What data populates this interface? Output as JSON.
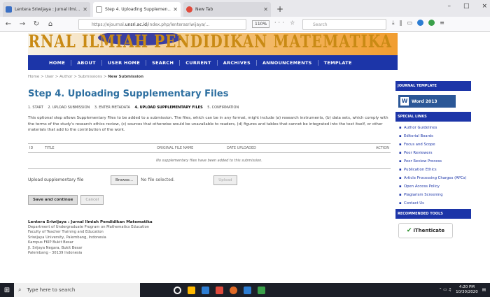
{
  "browser": {
    "tabs": [
      {
        "title": "Lentera Sriwijaya : Jurnal Ilmi...",
        "favicon_color": "#3a6fc4",
        "active": false
      },
      {
        "title": "Step 4. Uploading Supplemen...",
        "favicon_color": "#ffffff",
        "active": true
      },
      {
        "title": "New Tab",
        "favicon_color": "#e04a3c",
        "active": false
      }
    ],
    "new_tab": "+",
    "window_controls": [
      "–",
      "□",
      "×"
    ],
    "url_prefix": "https://ejournal.",
    "url_domain": "unsri.ac.id",
    "url_suffix": "/index.php/lenterasriwijaya/...",
    "zoom": "110%",
    "search_placeholder": "Search"
  },
  "site": {
    "journal_title": "JURNAL ILMIAH PENDIDIKAN MATEMATIKA",
    "menu": [
      "HOME",
      "ABOUT",
      "USER HOME",
      "SEARCH",
      "CURRENT",
      "ARCHIVES",
      "ANNOUNCEMENTS",
      "TEMPLATE"
    ]
  },
  "page": {
    "breadcrumb": [
      "Home",
      "User",
      "Author",
      "Submissions",
      "New Submission"
    ],
    "title": "Step 4. Uploading Supplementary Files",
    "steps": [
      "1. START",
      "2. UPLOAD SUBMISSION",
      "3. ENTER METADATA",
      "4. UPLOAD SUPPLEMENTARY FILES",
      "5. CONFIRMATION"
    ],
    "description": "This optional step allows Supplementary Files to be added to a submission. The files, which can be in any format, might include (a) research instruments, (b) data sets, which comply with the terms of the study's research ethics review, (c) sources that otherwise would be unavailable to readers, (d) figures and tables that cannot be integrated into the text itself, or other materials that add to the contribution of the work.",
    "table_headers": [
      "ID",
      "TITLE",
      "ORIGINAL FILE NAME",
      "DATE UPLOADED",
      "ACTION"
    ],
    "table_empty": "No supplementary files have been added to this submission.",
    "upload_label": "Upload supplementary file",
    "browse_label": "Browse...",
    "no_file": "No file selected.",
    "upload_button": "Upload",
    "save_button": "Save and continue",
    "cancel_button": "Cancel",
    "footer": {
      "heading": "Lentera Sriwijaya : Jurnal Ilmiah Pendidikan Matematika",
      "lines": [
        "Department of Undergraduate Program on Mathematics Education",
        "Faculty of Teacher Training and Education",
        "Sriwijaya University, Palembang, Indonesia",
        "Kampus FKIP Bukit Besar",
        "Jl. Srijaya Negara, Bukit Besar",
        "Palembang - 30139 Indonesia"
      ]
    }
  },
  "sidebar": {
    "template_heading": "JOURNAL TEMPLATE",
    "word_label": "Word 2013",
    "links_heading": "SPECIAL LINKS",
    "links": [
      "Author Guidelines",
      "Editorial Boards",
      "Focus and Scope",
      "Peer Reviewers",
      "Peer Review Process",
      "Publication Ethics",
      "Article Processing Charges (APCs)",
      "Open Access Policy",
      "Plagiarism Screening",
      "Contact Us"
    ],
    "tools_heading": "RECOMMENDED TOOLS",
    "tool_name": "iThenticate"
  },
  "taskbar": {
    "search_placeholder": "Type here to search",
    "time": "4:20 PM",
    "date": "10/30/2020",
    "app_colors": [
      "#f3f3f3",
      "#ffb900",
      "#2d7dd2",
      "#e04a3c",
      "#e06a26",
      "#2d7dd2",
      "#3aa04a"
    ]
  }
}
